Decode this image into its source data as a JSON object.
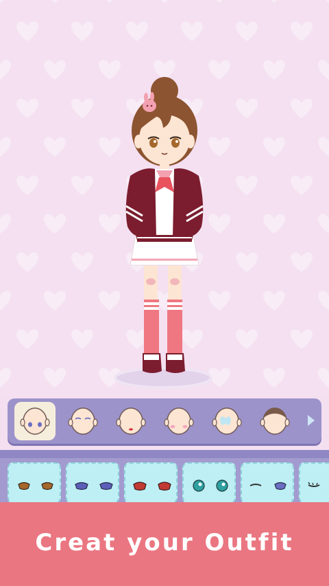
{
  "banner": {
    "text": "Creat your Outfit"
  },
  "categories": [
    {
      "icon": "face-base-icon",
      "selected": true
    },
    {
      "icon": "eyes-category-icon",
      "selected": false
    },
    {
      "icon": "mouth-category-icon",
      "selected": false
    },
    {
      "icon": "blush-category-icon",
      "selected": false
    },
    {
      "icon": "bandage-category-icon",
      "selected": false
    },
    {
      "icon": "hair-category-icon",
      "selected": false
    }
  ],
  "eye_items": [
    {
      "icon": "brown-eyes-icon",
      "color": "#a5672c"
    },
    {
      "icon": "blue-eyes-icon",
      "color": "#5c5fb8"
    },
    {
      "icon": "red-eyes-icon",
      "color": "#c23b33"
    },
    {
      "icon": "teal-crying-eyes-icon",
      "color": "#2f9fa0"
    },
    {
      "icon": "wink-eyes-icon",
      "color": "#6a6ec2"
    },
    {
      "icon": "closed-eyes-icon",
      "color": "#333333"
    }
  ],
  "colors": {
    "stage_bg": "#f4e0f1",
    "heart": "#f8ecf6",
    "bar": "#9d93cb",
    "tray": "#a39bcf",
    "item_bg": "#bdeff4",
    "banner": "#ea7681",
    "jacket": "#7b1d2f"
  }
}
